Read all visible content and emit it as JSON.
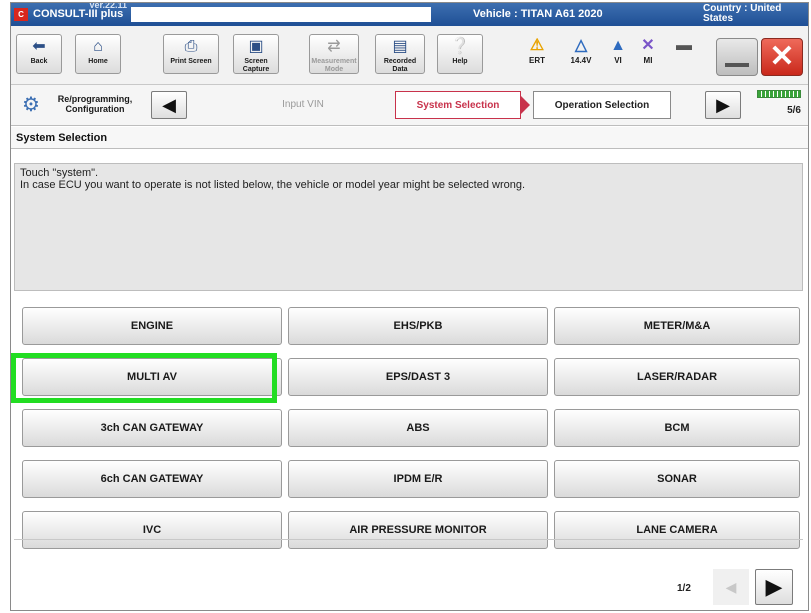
{
  "titlebar": {
    "logo": "C-III",
    "app_name": "CONSULT-III plus",
    "version_text": "Ver.22.11",
    "vehicle": "Vehicle : TITAN A61 2020",
    "country": "Country : United States"
  },
  "toolbar": {
    "buttons": [
      {
        "label": "Back",
        "icon": "back-arrow-icon"
      },
      {
        "label": "Home",
        "icon": "home-icon"
      },
      {
        "label": "Print Screen",
        "icon": "printer-icon"
      },
      {
        "label": "Screen Capture",
        "icon": "camera-icon"
      },
      {
        "label": "Measurement Mode",
        "icon": "measurement-icon"
      },
      {
        "label": "Recorded Data",
        "icon": "recorded-data-icon"
      },
      {
        "label": "Help",
        "icon": "help-icon"
      }
    ],
    "status": [
      {
        "label": "ERT",
        "icon": "warning-icon"
      },
      {
        "label": "14.4V",
        "icon": "vehicle-icon"
      },
      {
        "label": "VI",
        "icon": "signal-icon"
      },
      {
        "label": "MI",
        "icon": "no-connection-icon"
      }
    ]
  },
  "breadcrumb": {
    "mode": "Re/programming, Configuration",
    "steps": [
      "Input VIN",
      "System Selection",
      "Operation Selection"
    ],
    "progress": "5/6",
    "progress_fraction": 0.83
  },
  "section": {
    "title": "System Selection"
  },
  "instructions": {
    "line1": "Touch \"system\".",
    "line2": "In case ECU you want to operate is not listed below, the vehicle or model year might be selected wrong."
  },
  "systems": [
    [
      "ENGINE",
      "EHS/PKB",
      "METER/M&A"
    ],
    [
      "MULTI AV",
      "EPS/DAST 3",
      "LASER/RADAR"
    ],
    [
      "3ch CAN GATEWAY",
      "ABS",
      "BCM"
    ],
    [
      "6ch CAN GATEWAY",
      "IPDM E/R",
      "SONAR"
    ],
    [
      "IVC",
      "AIR PRESSURE MONITOR",
      "LANE CAMERA"
    ]
  ],
  "pager": {
    "text": "1/2"
  },
  "colors": {
    "highlight": "#22dd22",
    "active_step": "#c8324b",
    "title_bar": "#2a5ea3"
  }
}
